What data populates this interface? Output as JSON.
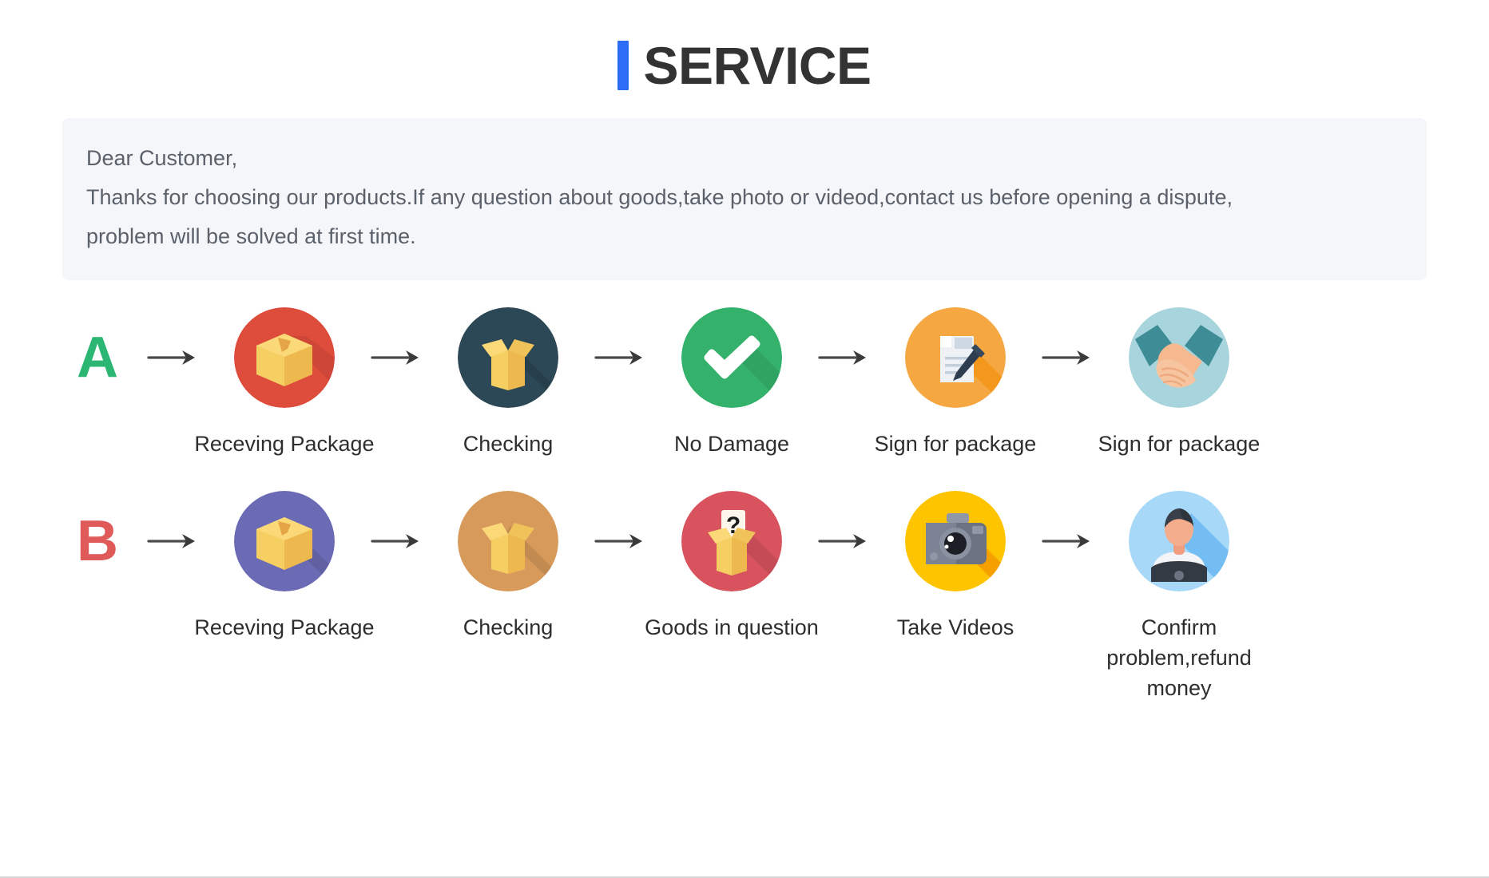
{
  "header": {
    "title": "SERVICE",
    "accent_color": "#2d6df6",
    "title_color": "#333333"
  },
  "notice": {
    "background": "#f4f6fa",
    "text_color": "#5b616b",
    "lines": [
      "Dear Customer,",
      "Thanks for choosing our products.If any question about goods,take photo or videod,contact us before opening a dispute,",
      "problem will be solved at first time."
    ]
  },
  "flows": [
    {
      "letter": "A",
      "letter_color": "#2bb673",
      "steps": [
        {
          "label": "Receving Package",
          "icon": "closed-box-icon",
          "circle_color": "#de4c3c"
        },
        {
          "label": "Checking",
          "icon": "open-box-icon",
          "circle_color": "#2c4756"
        },
        {
          "label": "No Damage",
          "icon": "checkmark-icon",
          "circle_color": "#34b16a"
        },
        {
          "label": "Sign for package",
          "icon": "document-pen-icon",
          "circle_color": "#f5a742"
        },
        {
          "label": "Sign for package",
          "icon": "handshake-icon",
          "circle_color": "#a8d5dd"
        }
      ]
    },
    {
      "letter": "B",
      "letter_color": "#e05a5a",
      "steps": [
        {
          "label": "Receving Package",
          "icon": "closed-box-icon",
          "circle_color": "#6b6bb5"
        },
        {
          "label": "Checking",
          "icon": "open-box-icon",
          "circle_color": "#d79a5b"
        },
        {
          "label": "Goods in question",
          "icon": "question-box-icon",
          "circle_color": "#d9535f"
        },
        {
          "label": "Take Videos",
          "icon": "camera-icon",
          "circle_color": "#ffc400"
        },
        {
          "label": "Confirm  problem,refund money",
          "icon": "support-person-icon",
          "circle_color": "#a8d8f8"
        }
      ]
    }
  ],
  "arrow": {
    "name": "arrow-right-icon",
    "color": "#4a4a4a"
  }
}
